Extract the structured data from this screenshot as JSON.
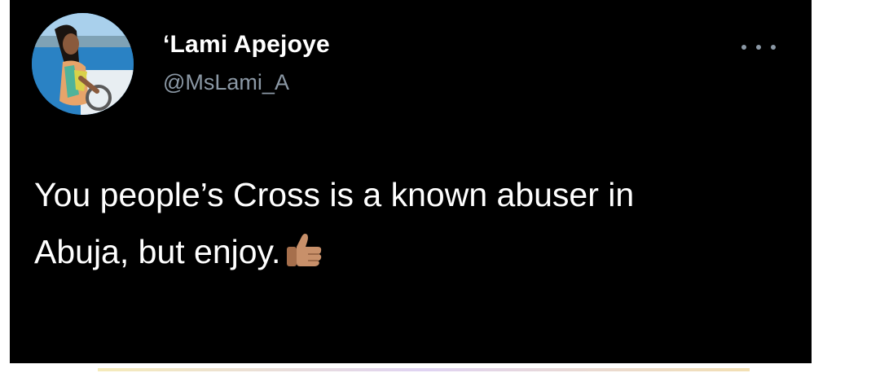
{
  "tweet": {
    "author": {
      "display_name": "‘Lami Apejoye",
      "handle": "@MsLami_A",
      "avatar": "profile-photo-woman-on-boat"
    },
    "more_icon": "more-horizontal-icon",
    "text_line1": "You people’s Cross is a known abuser in",
    "text_line2": "Abuja, but enjoy.",
    "emoji": "thumbs-up-medium-skin-tone"
  },
  "colors": {
    "background": "#000000",
    "text": "#ffffff",
    "secondary_text": "#8b98a5"
  }
}
